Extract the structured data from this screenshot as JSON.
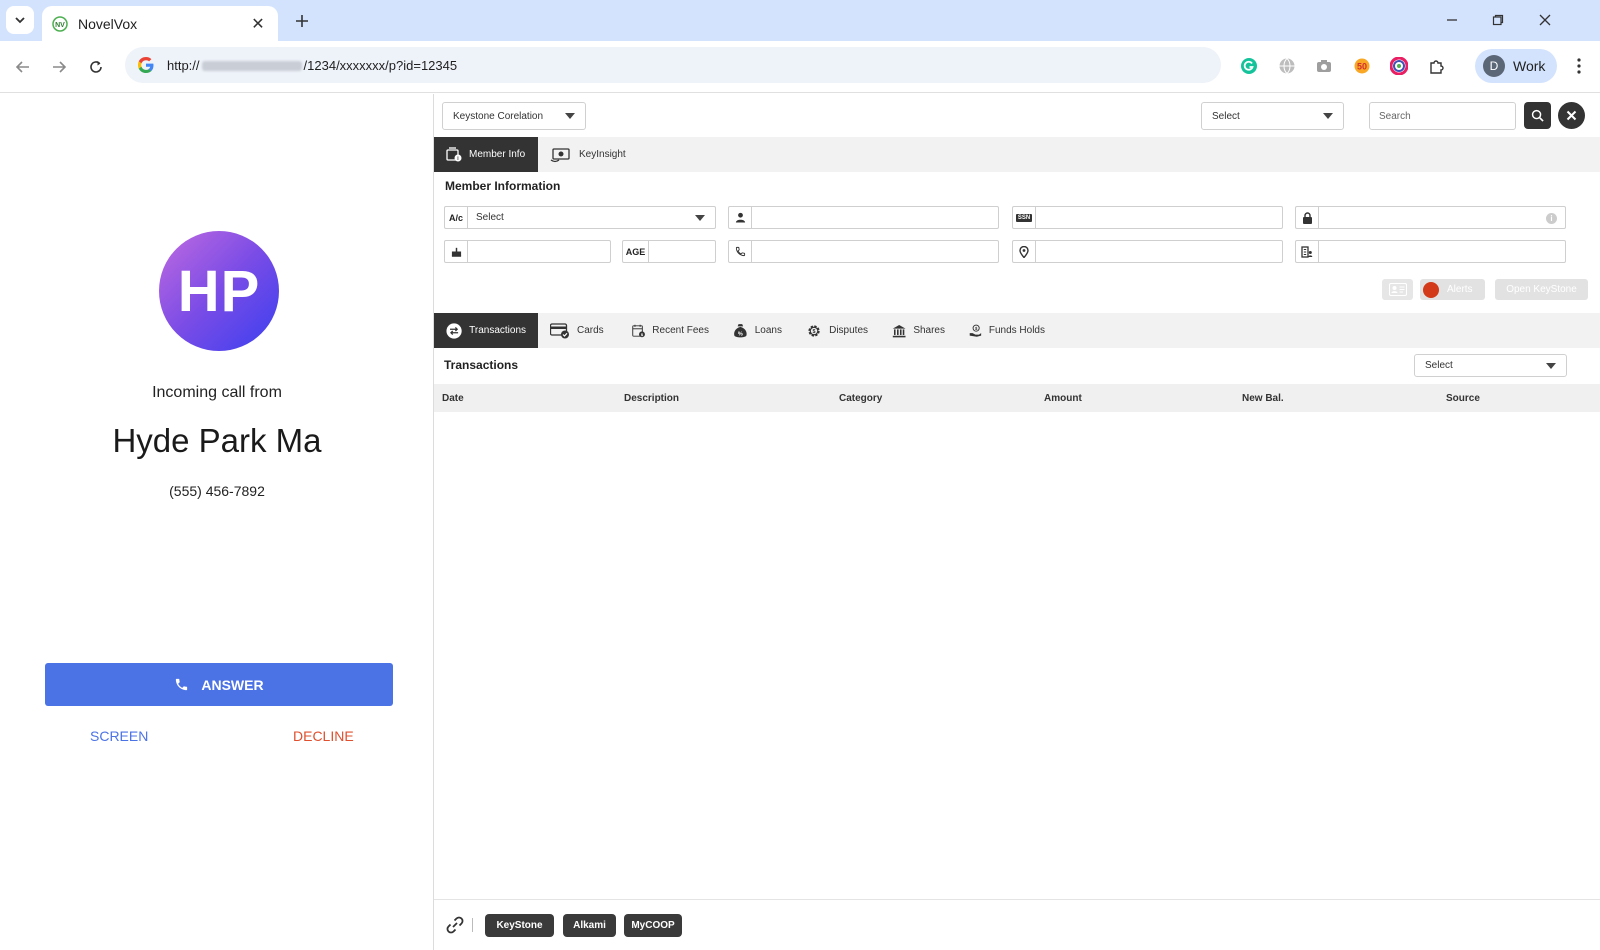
{
  "browser": {
    "tab_title": "NovelVox",
    "url_prefix": "http://",
    "url_suffix": "/1234/xxxxxxx/p?id=12345",
    "profile_initial": "D",
    "profile_label": "Work"
  },
  "call": {
    "avatar_initials": "HP",
    "incoming_label": "Incoming call from",
    "caller_name": "Hyde Park Ma",
    "caller_phone": "(555) 456-7892",
    "answer_label": "ANSWER",
    "screen_label": "SCREEN",
    "decline_label": "DECLINE"
  },
  "crm": {
    "source_select": "Keystone Corelation",
    "search_type_select": "Select",
    "search_placeholder": "Search",
    "top_tabs": [
      {
        "label": "Member Info"
      },
      {
        "label": "KeyInsight"
      }
    ],
    "member_section_title": "Member Information",
    "fields": {
      "account_label": "A/c",
      "account_value": "Select",
      "ssn_label": "SSN",
      "age_label": "AGE"
    },
    "alerts_label": "Alerts",
    "open_keystone_label": "Open KeyStone",
    "data_tabs": [
      {
        "label": "Transactions"
      },
      {
        "label": "Cards"
      },
      {
        "label": "Recent Fees"
      },
      {
        "label": "Loans"
      },
      {
        "label": "Disputes"
      },
      {
        "label": "Shares"
      },
      {
        "label": "Funds Holds"
      }
    ],
    "transactions_title": "Transactions",
    "transactions_filter": "Select",
    "columns": [
      "Date",
      "Description",
      "Category",
      "Amount",
      "New Bal.",
      "Source"
    ],
    "footer_links": [
      "KeyStone",
      "Alkami",
      "MyCOOP"
    ]
  },
  "colors": {
    "accent_blue": "#4c73e6",
    "decline_red": "#e0502e",
    "dark": "#333333",
    "alert_red": "#d23a1a"
  }
}
